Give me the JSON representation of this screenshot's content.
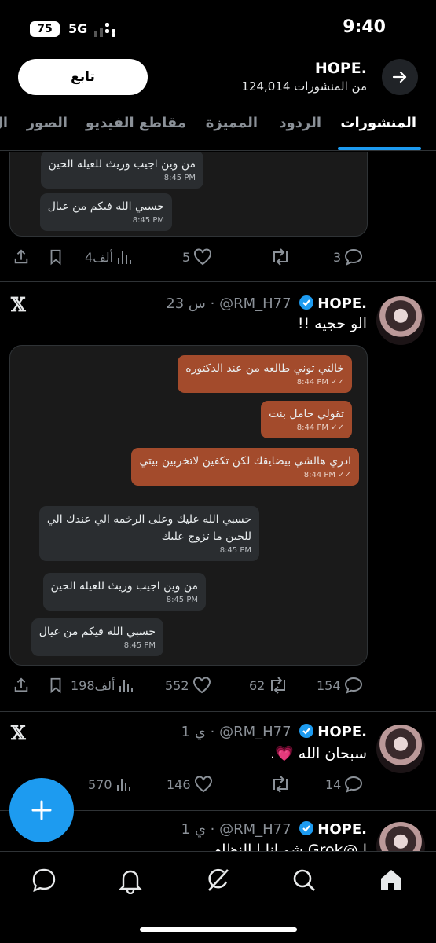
{
  "status_bar": {
    "time": "9:40",
    "battery": "75",
    "network": "5G"
  },
  "header": {
    "name": "HOPE.",
    "posts_count": "124,014 من المنشورات",
    "follow_label": "تابع"
  },
  "tabs": [
    {
      "label": "المنشورات",
      "active": true
    },
    {
      "label": "الردود"
    },
    {
      "label": "المميزة"
    },
    {
      "label": "مقاطع الفيديو"
    },
    {
      "label": "الصور"
    },
    {
      "label": "ال"
    }
  ],
  "posts": [
    {
      "partial": true,
      "chat": [
        {
          "dir": "in",
          "text": "من وين اجيب وريث للعيله الحين",
          "time": "8:45 PM"
        },
        {
          "dir": "in",
          "text": "حسبي الله فيكم من عيال",
          "time": "8:45 PM"
        }
      ],
      "replies": "3",
      "reposts": "",
      "likes": "5",
      "views": "4ألف"
    },
    {
      "display_name": "HOPE.",
      "handle": "@RM_H77",
      "time_ago": "23 س",
      "text": "الو حجيه !!",
      "chat": [
        {
          "dir": "out",
          "text": "خالتي توني طالعه من عند الدكتوره",
          "time": "8:44 PM ✓✓"
        },
        {
          "dir": "out",
          "text": "تقولي حامل بنت",
          "time": "8:44 PM ✓✓"
        },
        {
          "dir": "out",
          "text": "ادري هالشي بيضايقك لكن تكفين لاتخربين بيتي",
          "time": "8:44 PM ✓✓"
        },
        {
          "dir": "in",
          "text": "حسبي الله عليك وعلى الرخمه الي عندك الي",
          "text2": "للحين ما تزوج عليك",
          "time": "8:45 PM"
        },
        {
          "dir": "in",
          "text": "من وين اجيب وريث للعيله الحين",
          "time": "8:45 PM"
        },
        {
          "dir": "in",
          "text": "حسبي الله فيكم من عيال",
          "time": "8:45 PM"
        }
      ],
      "replies": "154",
      "reposts": "62",
      "likes": "552",
      "views": "198ألف"
    },
    {
      "display_name": "HOPE.",
      "handle": "@RM_H77",
      "time_ago": "1 ي",
      "text": "سبحان الله 💗.",
      "replies": "14",
      "reposts": "",
      "likes": "146",
      "views": "570"
    },
    {
      "display_name": "HOPE.",
      "handle": "@RM_H77",
      "time_ago": "1 ي",
      "text": "ا @Grok شو انا ا النظام ..."
    }
  ],
  "colors": {
    "accent": "#1d9bf0",
    "outgoing_bubble": "#a34b2c",
    "incoming_bubble": "#2a2d30"
  },
  "bottom_nav": [
    "home-icon",
    "search-icon",
    "grok-icon",
    "notifications-icon",
    "messages-icon"
  ]
}
